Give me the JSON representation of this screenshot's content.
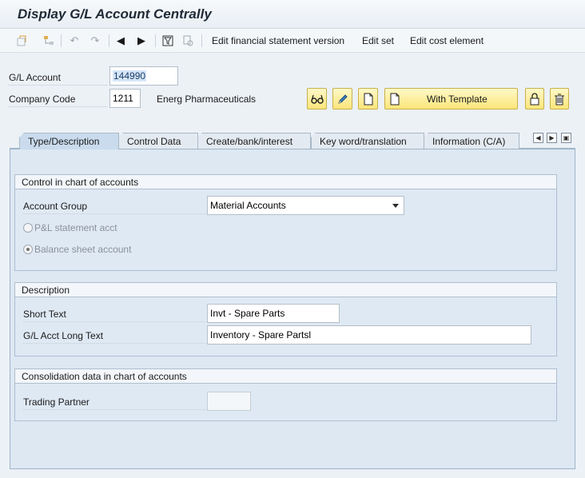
{
  "window": {
    "title": "Display G/L Account Centrally"
  },
  "toolbar": {
    "links": [
      "Edit financial statement version",
      "Edit set",
      "Edit cost element"
    ]
  },
  "header": {
    "gl_account_label": "G/L Account",
    "gl_account_value": "144990",
    "company_code_label": "Company Code",
    "company_code_value": "1211",
    "company_name": "Energ Pharmaceuticals",
    "with_template_label": "With Template"
  },
  "tabs": [
    {
      "label": "Type/Description"
    },
    {
      "label": "Control Data"
    },
    {
      "label": "Create/bank/interest"
    },
    {
      "label": "Key word/translation"
    },
    {
      "label": "Information (C/A)"
    }
  ],
  "control_group": {
    "title": "Control in chart of accounts",
    "account_group_label": "Account Group",
    "account_group_value": "Material Accounts",
    "pl_label": "P&L statement acct",
    "bs_label": "Balance sheet account"
  },
  "description_group": {
    "title": "Description",
    "short_text_label": "Short Text",
    "short_text_value": "Invt - Spare Parts",
    "long_text_label": "G/L Acct Long Text",
    "long_text_value": "Inventory - Spare Partsl"
  },
  "consolidation_group": {
    "title": "Consolidation data in chart of accounts",
    "trading_partner_label": "Trading Partner",
    "trading_partner_value": ""
  },
  "colors": {
    "accent_button": "#fbe67a",
    "panel": "#dde8f3"
  }
}
